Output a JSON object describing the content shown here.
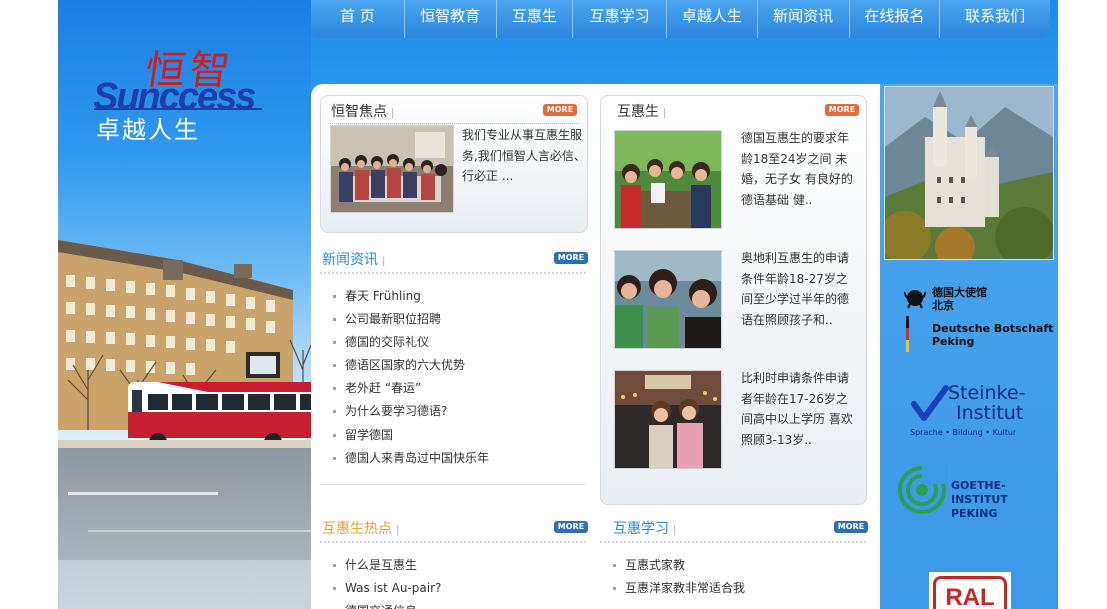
{
  "brand": {
    "logo_cn": "恒智",
    "logo_en": "Sunccess",
    "slogan": "卓越人生"
  },
  "nav": {
    "items": [
      "首 页",
      "恒智教育",
      "互惠生",
      "互惠学习",
      "卓越人生",
      "新闻资讯",
      "在线报名",
      "联系我们"
    ]
  },
  "more_label": "MORE",
  "focus": {
    "title": "恒智焦点",
    "text": "我们专业从事互惠生服务,我们恒智人言必信、行必正 ..."
  },
  "aupair": {
    "title": "互惠生",
    "items": [
      {
        "text": "德国互惠生的要求年龄18至24岁之间 未婚，无子女 有良好的德语基础 健.."
      },
      {
        "text": "奥地利互惠生的申请条件年龄18-27岁之间至少学过半年的德语在照顾孩子和.."
      },
      {
        "text": "比利时申请条件申请者年龄在17-26岁之间高中以上学历 喜欢照顾3-13岁.."
      }
    ]
  },
  "news": {
    "title": "新闻资讯",
    "items": [
      "春天 Frühling",
      "公司最新职位招聘",
      "德国的交际礼仪",
      "德语区国家的六大优势",
      "老外赶 “春运”",
      "为什么要学习德语?",
      "留学德国",
      "德国人来青岛过中国快乐年"
    ]
  },
  "hot": {
    "title": "互惠生热点",
    "items": [
      "什么是互惠生",
      "Was ist Au-pair?",
      "德国交通信息"
    ]
  },
  "study": {
    "title": "互惠学习",
    "items": [
      "互惠式家教",
      "互惠洋家教非常适合我"
    ]
  },
  "partners": {
    "embassy_line1": "德国大使馆",
    "embassy_line2": "北京",
    "embassy_line3": "Deutsche Botschaft",
    "embassy_line4": "Peking",
    "steinke_line1": "Steinke-",
    "steinke_line2": "Institut",
    "steinke_line3": "Sprache • Bildung • Kultur",
    "goethe_line1": "GOETHE-INSTITUT",
    "goethe_line2": "PEKING",
    "ral": "RAL"
  },
  "colors": {
    "accent_blue": "#2b8ad6",
    "accent_orange": "#e5a33a",
    "logo_red": "#d21b1b",
    "logo_blue": "#1a3fa8"
  }
}
